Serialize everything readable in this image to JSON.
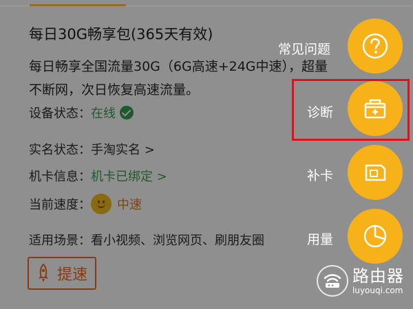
{
  "plan": {
    "title": "每日30G畅享包(365天有效)",
    "description_lines": [
      "每日畅享全国流量30G（6G高速+24G中速），超量",
      "不断网，次日恢复高速流量。"
    ]
  },
  "details": {
    "device_status": {
      "label": "设备状态：",
      "value": "在线"
    },
    "realname_status": {
      "label": "实名状态：",
      "value": "手淘实名 >"
    },
    "card_info": {
      "label": "机卡信息：",
      "value": "机卡已绑定 >"
    },
    "current_speed": {
      "label": "当前速度：",
      "value": "中速"
    },
    "scenarios": {
      "label": "适用场景：",
      "value": "看小视频、浏览网页、刷朋友圈"
    }
  },
  "boost_button": {
    "label": "提速"
  },
  "fab_menu": [
    {
      "label": "常见问题",
      "icon": "question-icon"
    },
    {
      "label": "诊断",
      "icon": "toolbox-icon"
    },
    {
      "label": "补卡",
      "icon": "sim-card-icon"
    },
    {
      "label": "用量",
      "icon": "pie-chart-icon"
    }
  ],
  "watermark": {
    "cn": "路由器",
    "en": "luyouqi.com"
  },
  "colors": {
    "fab": "#f7b21a",
    "highlight": "#e0101a",
    "overlay_bg": "#8f8f8f"
  }
}
